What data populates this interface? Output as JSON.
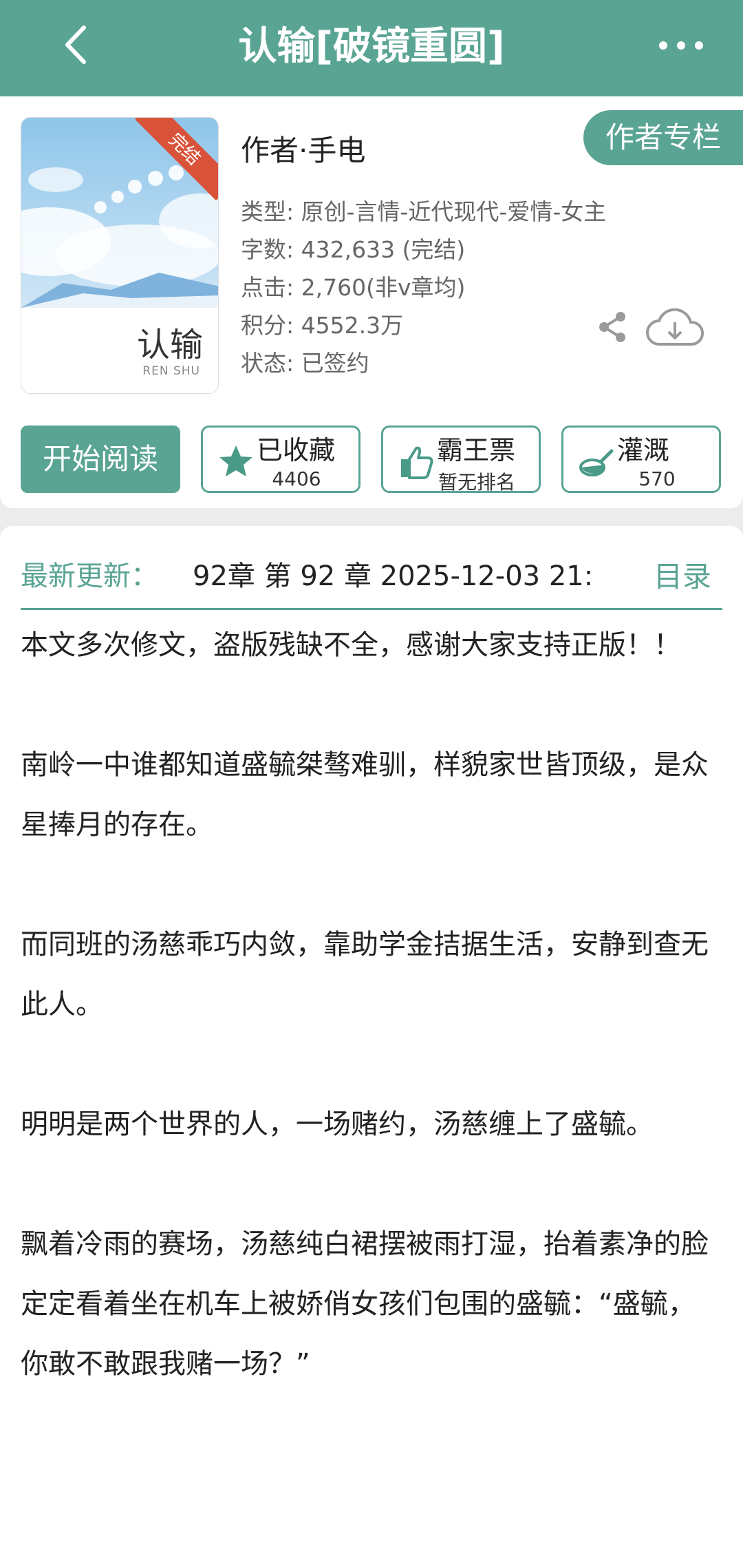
{
  "header": {
    "title": "认输[破镜重圆]",
    "back_icon": "chevron-left-icon",
    "more_icon": "more-dots-icon"
  },
  "book": {
    "cover_title": "认输",
    "cover_subtitle": "REN SHU",
    "ribbon": "完结",
    "author": "作者·手电",
    "author_column_button": "作者专栏",
    "meta": [
      "类型: 原创-言情-近代现代-爱情-女主",
      "字数: 432,633 (完结)",
      "点击: 2,760(非v章均)",
      "积分: 4552.3万",
      "状态: 已签约"
    ]
  },
  "actions": {
    "read_label": "开始阅读",
    "collect_label": "已收藏",
    "collect_count": "4406",
    "vote_label": "霸王票",
    "vote_sub": "暂无排名",
    "nutrient_label": "灌溉",
    "nutrient_count": "570"
  },
  "update": {
    "label": "最新更新：",
    "text": "92章  第 92 章  2025-12-03 21:",
    "toc_label": "目录"
  },
  "description": [
    "本文多次修文，盗版残缺不全，感谢大家支持正版！！",
    "南岭一中谁都知道盛毓桀骜难驯，样貌家世皆顶级，是众星捧月的存在。",
    "而同班的汤慈乖巧内敛，靠助学金拮据生活，安静到查无此人。",
    "明明是两个世界的人，一场赌约，汤慈缠上了盛毓。",
    "飘着冷雨的赛场，汤慈纯白裙摆被雨打湿，抬着素净的脸定定看着坐在机车上被娇俏女孩们包围的盛毓：“盛毓，你敢不敢跟我赌一场？”"
  ],
  "colors": {
    "accent": "#5aa494",
    "ribbon": "#d9533a"
  }
}
